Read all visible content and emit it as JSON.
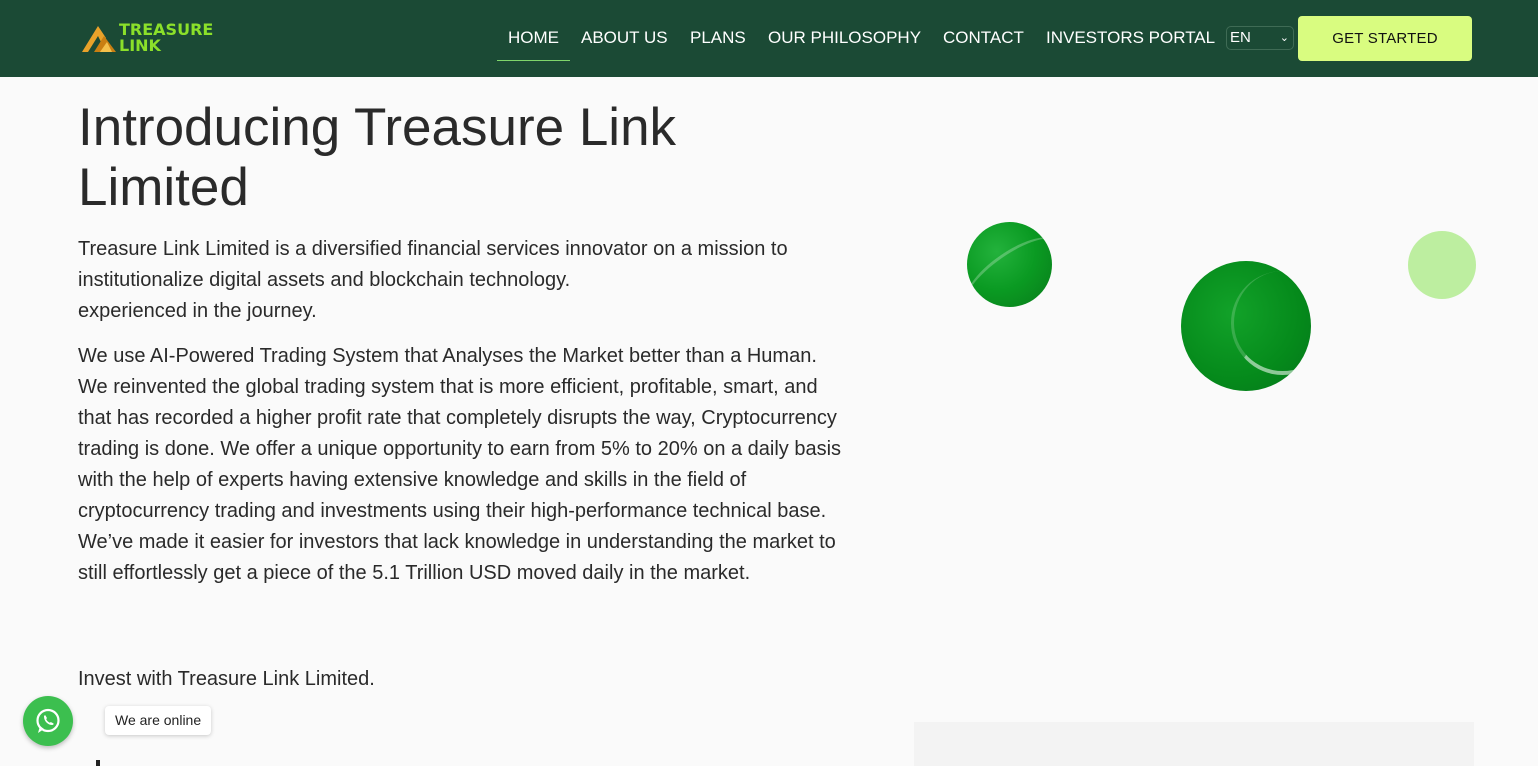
{
  "brand": {
    "logo_line1": "TREASURE",
    "logo_line2": "LINK",
    "logo_color": "#8be02a"
  },
  "nav": {
    "items": [
      {
        "label": "HOME",
        "active": true
      },
      {
        "label": "ABOUT US"
      },
      {
        "label": "PLANS"
      },
      {
        "label": "OUR PHILOSOPHY"
      },
      {
        "label": "CONTACT"
      },
      {
        "label": "INVESTORS PORTAL"
      }
    ],
    "language": "EN",
    "cta_label": "GET STARTED"
  },
  "hero": {
    "title": "Introducing Treasure Link Limited",
    "intro": "Treasure Link Limited is a diversified financial services innovator on a mission to institutionalize digital assets and blockchain technology.",
    "intro_extra": "experienced in the journey.",
    "body": "We use AI-Powered Trading System that Analyses the Market better than a Human. We reinvented the global trading system that is more efficient, profitable, smart, and that has recorded a higher profit rate that completely disrupts the way, Cryptocurrency trading is done. We offer a unique opportunity to earn from 5% to 20% on a daily basis with the help of experts having extensive knowledge and skills in the field of cryptocurrency trading and investments using their high-performance technical base.",
    "body_extra": "We’ve made it easier for investors that lack knowledge in understanding the market to still effortlessly get a piece of the 5.1 Trillion USD moved daily in the market.",
    "closing": "Invest with Treasure Link Limited."
  },
  "chat": {
    "icon": "whatsapp-icon",
    "status": "We are online"
  },
  "colors": {
    "navbar": "#1b4a35",
    "cta": "#d9fc80",
    "accent_green": "#058a1b",
    "light_green": "#bdeea0"
  }
}
